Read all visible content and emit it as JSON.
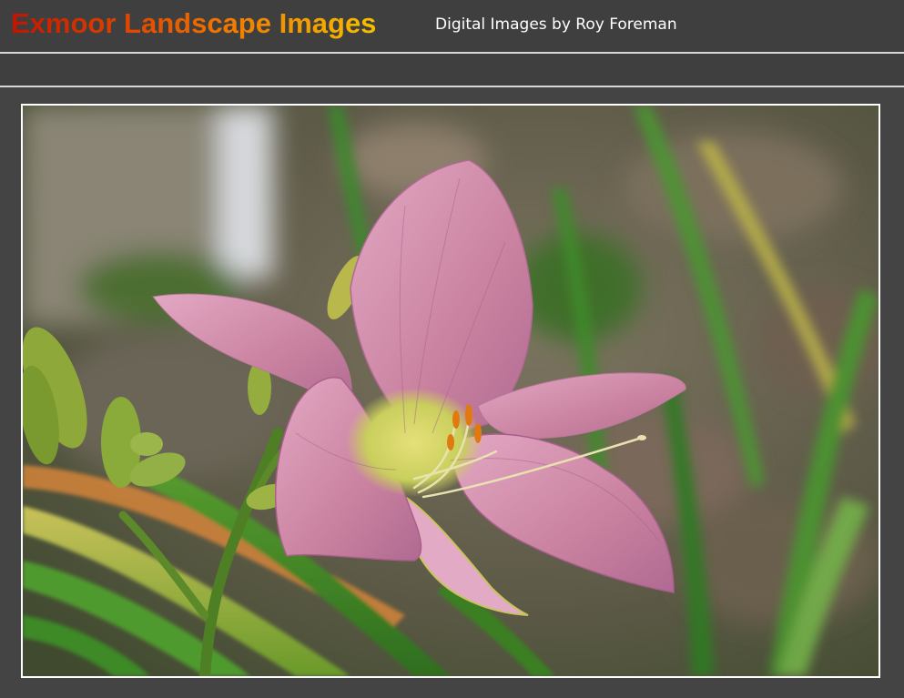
{
  "header": {
    "site_title": "Exmoor Landscape Images",
    "subtitle": "Digital Images by Roy Foreman"
  },
  "photo": {
    "subject": "pink-daylily-photo",
    "colors": {
      "petal": "#c98aa8",
      "petal_edge": "#b86f98",
      "throat": "#d9d36a",
      "stem": "#5c8a2a",
      "leaf": "#3f8c2a",
      "background": "#6f6a58"
    }
  },
  "theme": {
    "page_bg": "#444444",
    "rule_color": "#d8d8d8",
    "frame_border": "#ffffff"
  }
}
